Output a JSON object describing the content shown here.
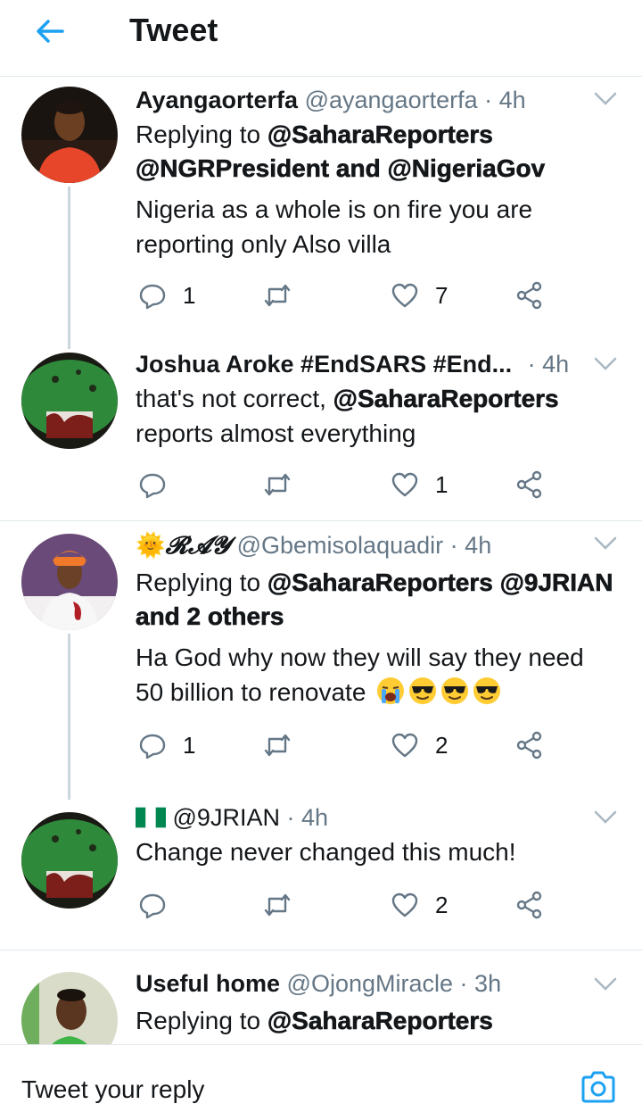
{
  "header": {
    "title": "Tweet",
    "back_icon": "back-arrow-icon"
  },
  "colors": {
    "accent": "#1da1f2",
    "secondary_text": "#657786",
    "icon_gray": "#657786",
    "border": "#e1e8ed"
  },
  "tweets": [
    {
      "name": "Ayangaorterfa",
      "handle": "@ayangaorterfa",
      "time": "4h",
      "replying_prefix": "Replying to",
      "replying_line1": "@SaharaReporters",
      "replying_line2": "@NGRPresident and @NigeriaGov",
      "text": "Nigeria as a whole is on fire you are reporting only Also villa",
      "replies": "1",
      "retweets": "",
      "likes": "7"
    },
    {
      "name": "Joshua Aroke #EndSARS #End...",
      "handle": "",
      "time": "4h",
      "text_prefix": "that's not correct,",
      "text_mention": "@SaharaReporters",
      "text_suffix": "reports almost everything",
      "replies": "",
      "retweets": "",
      "likes": "1"
    },
    {
      "name_emoji": "🌞",
      "name": "𝓡𝓐𝓨",
      "handle": "@Gbemisolaquadir",
      "time": "4h",
      "replying_prefix": "Replying to",
      "replying_line1": "@SaharaReporters @9JRIAN",
      "replying_line2": "and 2 others",
      "text_line1": "Ha God why now they will say they need",
      "text_line2": "50 billion to renovate",
      "emojis": [
        "loudly-crying-face",
        "sunglasses-face",
        "sunglasses-face",
        "sunglasses-face"
      ],
      "replies": "1",
      "retweets": "",
      "likes": "2"
    },
    {
      "flag": "nigeria-flag-icon",
      "handle": "@9JRIAN",
      "time": "4h",
      "text": "Change never changed this much!",
      "replies": "",
      "retweets": "",
      "likes": "2"
    },
    {
      "name": "Useful home",
      "handle": "@OjongMiracle",
      "time": "3h",
      "replying_prefix": "Replying to",
      "replying_line1": "@SaharaReporters"
    }
  ],
  "reply_bar": {
    "placeholder": "Tweet your reply",
    "camera_icon": "camera-icon"
  },
  "separator": "·"
}
